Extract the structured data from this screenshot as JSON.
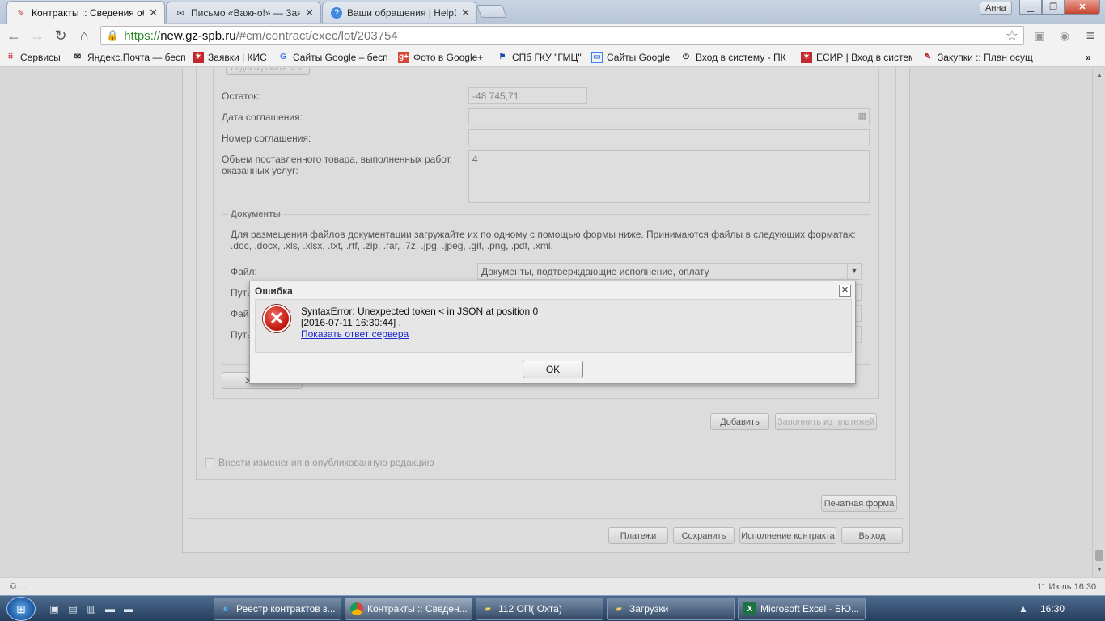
{
  "browser": {
    "tabs": [
      {
        "title": "Контракты :: Сведения об",
        "icon": "tools-icon"
      },
      {
        "title": "Письмо «Важно!» — Заяв",
        "icon": "mail-icon"
      },
      {
        "title": "Ваши обращения | HelpD",
        "icon": "help-icon"
      }
    ],
    "user": "Анна",
    "url": {
      "scheme": "https://",
      "host": "new.gz-spb.ru",
      "path": "/#cm/contract/exec/lot/203754"
    },
    "bookmarks": [
      {
        "label": "Сервисы",
        "icon": "apps-icon"
      },
      {
        "label": "Яндекс.Почта — бесп",
        "icon": "mail-icon"
      },
      {
        "label": "Заявки | КИС",
        "icon": "emblem-icon"
      },
      {
        "label": "Сайты Google – бесп",
        "icon": "google-icon"
      },
      {
        "label": "Фото в Google+",
        "icon": "gplus-icon"
      },
      {
        "label": "СПб ГКУ \"ГМЦ\"",
        "icon": "flag-icon"
      },
      {
        "label": "Сайты Google",
        "icon": "sites-icon"
      },
      {
        "label": "Вход в систему - ПК",
        "icon": "power-icon"
      },
      {
        "label": "ЕСИР | Вход в систем",
        "icon": "emblem-icon"
      },
      {
        "label": "Закупки :: План осущ",
        "icon": "tools-icon"
      }
    ]
  },
  "form": {
    "edit_button_partial": "Редактировать КЭР",
    "remainder_label": "Остаток:",
    "remainder_value": "-48 745,71",
    "agreement_date_label": "Дата соглашения:",
    "agreement_number_label": "Номер соглашения:",
    "volume_label": "Объем поставленного товара, выполненных работ, оказанных услуг:",
    "volume_value": "4",
    "docs_legend": "Документы",
    "docs_hint": "Для размещения файлов документации загружайте их по одному с помощью формы ниже. Принимаются файлы в следующих форматах: .doc, .docx, .xls, .xlsx, .txt, .rtf, .zip, .rar, .7z, .jpg, .jpeg, .gif, .png, .pdf, .xml.",
    "file_label": "Файл:",
    "file_select": "Документы, подтверждающие исполнение, оплату",
    "path_label": "Путь",
    "file_label2": "Файл",
    "path_label2": "Путь",
    "delete_button_partial": "У",
    "add_button": "Добавить",
    "fill_button": "Заполнить из платежей",
    "publish_checkbox_label": "Внести изменения в опубликованную редакцию",
    "print_button": "Печатная форма",
    "payments_button": "Платежи",
    "save_button": "Сохранить",
    "execution_button": "Исполнение контракта",
    "exit_button": "Выход"
  },
  "dialog": {
    "title": "Ошибка",
    "message_line1": "SyntaxError: Unexpected token < in JSON at position 0",
    "message_line2": "[2016-07-11 16:30:44] .",
    "link": "Показать ответ сервера",
    "ok": "OK"
  },
  "status": {
    "left": "© ...",
    "right": "11 Июль 16:30"
  },
  "taskbar": {
    "items": [
      {
        "label": "Реестр контрактов з...",
        "icon": "ie-icon"
      },
      {
        "label": "Контракты :: Сведен...",
        "icon": "chrome-icon"
      },
      {
        "label": "112 ОП( Охта)",
        "icon": "folder-icon"
      },
      {
        "label": "Загрузки",
        "icon": "folder-icon"
      },
      {
        "label": "Microsoft Excel - БЮ...",
        "icon": "excel-icon"
      }
    ],
    "clock": "16:30"
  },
  "colors": {
    "link": "#1c2bd0",
    "error_red": "#c0150b",
    "https_green": "#2f8a2f"
  }
}
